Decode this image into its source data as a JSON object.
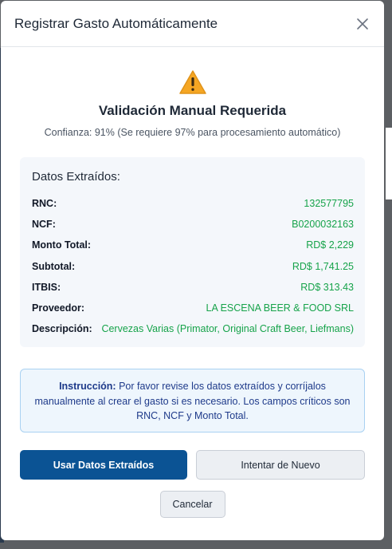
{
  "modal": {
    "title": "Registrar Gasto Automáticamente",
    "close_icon": "close-icon"
  },
  "status": {
    "icon": "warning-icon",
    "heading": "Validación Manual Requerida",
    "confidence": "Confianza: 91% (Se requiere 97% para procesamiento automático)"
  },
  "extracted": {
    "title": "Datos Extraídos:",
    "fields": [
      {
        "label": "RNC:",
        "value": "132577795"
      },
      {
        "label": "NCF:",
        "value": "B0200032163"
      },
      {
        "label": "Monto Total:",
        "value": "RD$ 2,229"
      },
      {
        "label": "Subtotal:",
        "value": "RD$ 1,741.25"
      },
      {
        "label": "ITBIS:",
        "value": "RD$ 313.43"
      },
      {
        "label": "Proveedor:",
        "value": "LA ESCENA BEER & FOOD SRL"
      },
      {
        "label": "Descripción:",
        "value": "Cervezas Varias (Primator, Original Craft Beer, Liefmans)"
      }
    ]
  },
  "instruction": {
    "label": "Instrucción:",
    "text": " Por favor revise los datos extraídos y corríjalos manualmente al crear el gasto si es necesario. Los campos críticos son RNC, NCF y Monto Total."
  },
  "actions": {
    "use_data": "Usar Datos Extraídos",
    "retry": "Intentar de Nuevo",
    "cancel": "Cancelar"
  },
  "colors": {
    "primary": "#0b5394",
    "value_green": "#16a34a",
    "warning": "#f5a623"
  }
}
